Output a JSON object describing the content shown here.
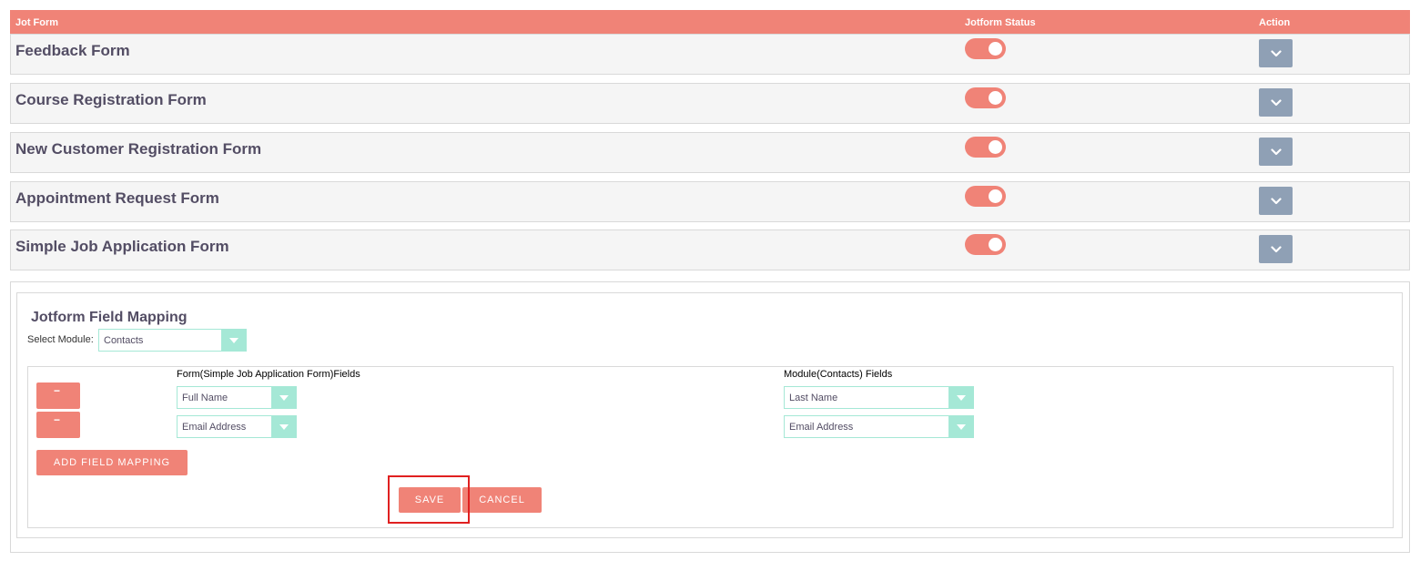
{
  "table": {
    "headers": {
      "name": "Jot Form",
      "status": "Jotform Status",
      "action": "Action"
    },
    "rows": [
      {
        "name": "Feedback Form",
        "status_on": true
      },
      {
        "name": "Course Registration Form",
        "status_on": true
      },
      {
        "name": "New Customer Registration Form",
        "status_on": true
      },
      {
        "name": "Appointment Request Form",
        "status_on": true
      },
      {
        "name": "Simple Job Application Form",
        "status_on": true
      }
    ]
  },
  "mapping": {
    "title": "Jotform Field Mapping",
    "module_label": "Select Module:",
    "module_value": "Contacts",
    "form_fields_header": "Form(Simple Job Application Form)Fields",
    "module_fields_header": "Module(Contacts) Fields",
    "pairs": [
      {
        "remove_label": "−",
        "form_field": "Full Name",
        "module_field": "Last Name"
      },
      {
        "remove_label": "−",
        "form_field": "Email Address",
        "module_field": "Email Address"
      }
    ],
    "add_label": "ADD FIELD MAPPING",
    "save_label": "SAVE",
    "cancel_label": "CANCEL"
  },
  "colors": {
    "accent": "#f08377",
    "select_accent": "#a5e8d6",
    "action_button": "#8fa0b5",
    "highlight": "#e02020"
  },
  "icons": {
    "action": "chevron-down-icon",
    "select": "caret-down-icon",
    "remove": "minus-icon"
  }
}
